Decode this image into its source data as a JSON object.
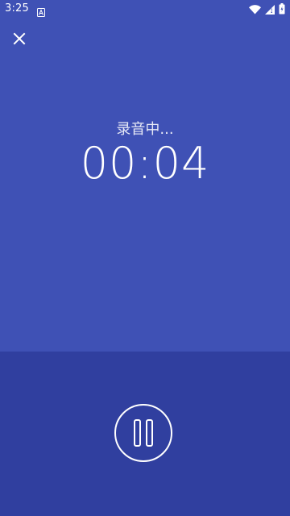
{
  "status_bar": {
    "time": "3:25",
    "icons": [
      "notification-a-icon",
      "wifi-icon",
      "signal-icon",
      "battery-icon"
    ]
  },
  "toolbar": {
    "close_icon": "close-icon"
  },
  "recording": {
    "status_text": "录音中...",
    "elapsed": "00:04"
  },
  "controls": {
    "pause_icon": "pause-icon"
  },
  "colors": {
    "primary": "#3f51b5",
    "primary_dark": "#303f9f",
    "on_primary": "#ffffff"
  }
}
